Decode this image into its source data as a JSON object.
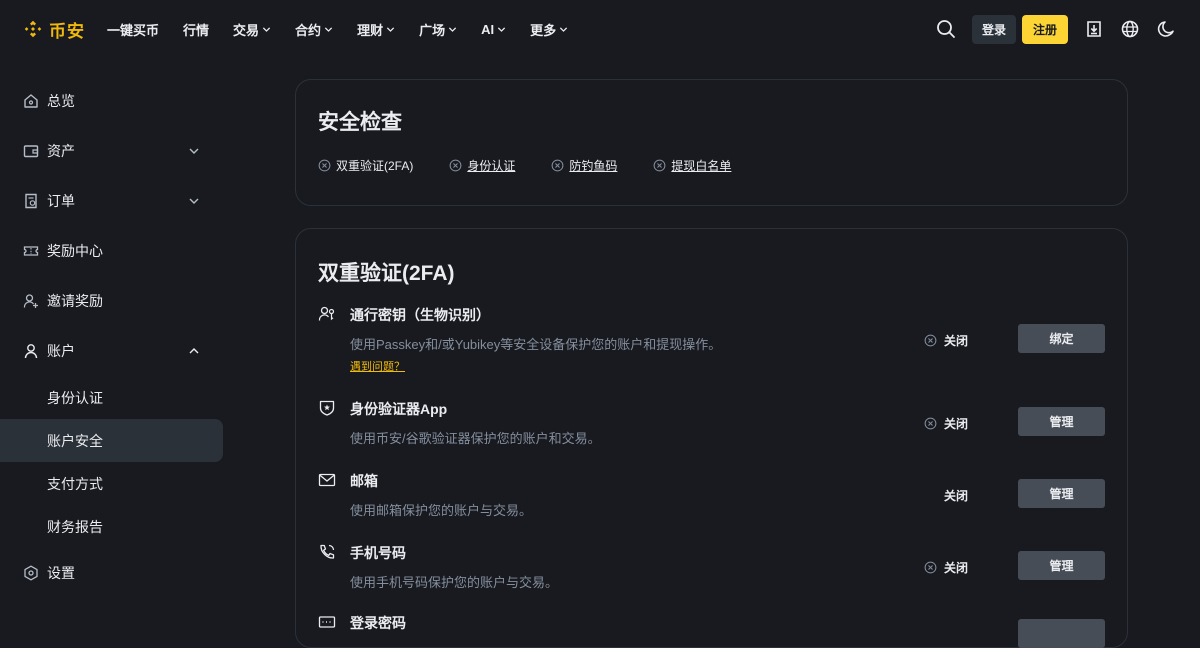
{
  "header": {
    "brand": "币安",
    "nav": [
      {
        "label": "一键买币",
        "dropdown": false
      },
      {
        "label": "行情",
        "dropdown": false
      },
      {
        "label": "交易",
        "dropdown": true
      },
      {
        "label": "合约",
        "dropdown": true
      },
      {
        "label": "理财",
        "dropdown": true
      },
      {
        "label": "广场",
        "dropdown": true
      },
      {
        "label": "AI",
        "dropdown": true
      },
      {
        "label": "更多",
        "dropdown": true
      }
    ],
    "login_label": "登录",
    "register_label": "注册"
  },
  "sidebar": {
    "items": [
      {
        "label": "总览"
      },
      {
        "label": "资产"
      },
      {
        "label": "订单"
      },
      {
        "label": "奖励中心"
      },
      {
        "label": "邀请奖励"
      },
      {
        "label": "账户"
      },
      {
        "label": "设置"
      }
    ],
    "account_subitems": [
      {
        "label": "身份认证"
      },
      {
        "label": "账户安全"
      },
      {
        "label": "支付方式"
      },
      {
        "label": "财务报告"
      }
    ]
  },
  "security_check": {
    "title": "安全检查",
    "items": [
      {
        "label": "双重验证(2FA)"
      },
      {
        "label": "身份认证"
      },
      {
        "label": "防钓鱼码"
      },
      {
        "label": "提现白名单"
      }
    ]
  },
  "twofa": {
    "title": "双重验证(2FA)",
    "rows": [
      {
        "title": "通行密钥（生物识别）",
        "desc": "使用Passkey和/或Yubikey等安全设备保护您的账户和提现操作。",
        "link": "遇到问题？",
        "status": "关闭",
        "button": "绑定"
      },
      {
        "title": "身份验证器App",
        "desc": "使用币安/谷歌验证器保护您的账户和交易。",
        "status": "关闭",
        "button": "管理"
      },
      {
        "title": "邮箱",
        "desc": "使用邮箱保护您的账户与交易。",
        "status": "关闭",
        "button": "管理"
      },
      {
        "title": "手机号码",
        "desc": "使用手机号码保护您的账户与交易。",
        "status": "关闭",
        "button": "管理"
      },
      {
        "title": "登录密码"
      }
    ]
  },
  "colors": {
    "background": "#181a20",
    "brand_yellow": "#f0b90b",
    "register_button": "#fcd535",
    "secondary_button": "#474d57",
    "muted_text": "#848e9c"
  }
}
